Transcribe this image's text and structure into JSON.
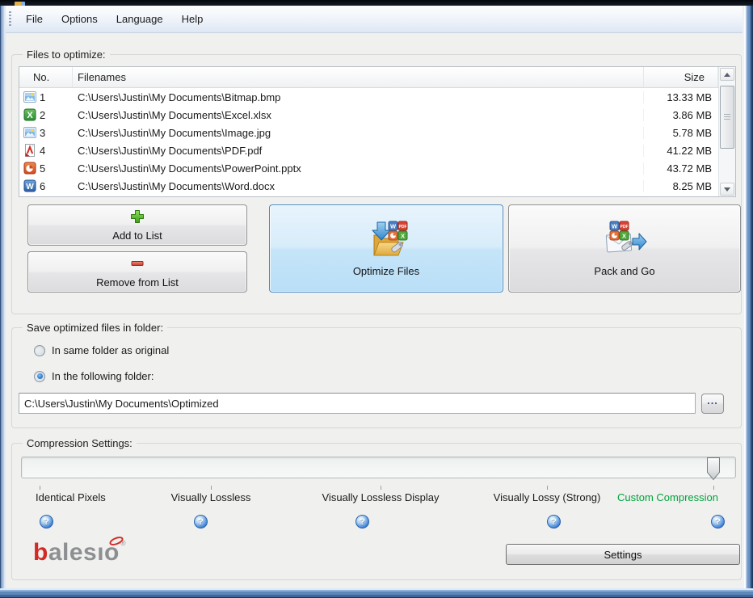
{
  "menu": {
    "items": [
      "File",
      "Options",
      "Language",
      "Help"
    ]
  },
  "files_group": {
    "label": "Files to optimize:",
    "columns": {
      "no": "No.",
      "filenames": "Filenames",
      "size": "Size"
    },
    "rows": [
      {
        "no": "1",
        "icon": "image-file-icon",
        "filename": "C:\\Users\\Justin\\My Documents\\Bitmap.bmp",
        "size": "13.33 MB"
      },
      {
        "no": "2",
        "icon": "excel-file-icon",
        "filename": "C:\\Users\\Justin\\My Documents\\Excel.xlsx",
        "size": "3.86 MB"
      },
      {
        "no": "3",
        "icon": "image-file-icon",
        "filename": "C:\\Users\\Justin\\My Documents\\Image.jpg",
        "size": "5.78 MB"
      },
      {
        "no": "4",
        "icon": "pdf-file-icon",
        "filename": "C:\\Users\\Justin\\My Documents\\PDF.pdf",
        "size": "41.22 MB"
      },
      {
        "no": "5",
        "icon": "powerpoint-file-icon",
        "filename": "C:\\Users\\Justin\\My Documents\\PowerPoint.pptx",
        "size": "43.72 MB"
      },
      {
        "no": "6",
        "icon": "word-file-icon",
        "filename": "C:\\Users\\Justin\\My Documents\\Word.docx",
        "size": "8.25 MB"
      }
    ],
    "add_button": "Add to List",
    "remove_button": "Remove from List",
    "optimize_button": "Optimize Files",
    "pack_button": "Pack and Go"
  },
  "save_group": {
    "label": "Save optimized files in folder:",
    "option_same_folder": "In same folder as original",
    "option_following_folder": "In the following folder:",
    "selected_option": "In the following folder:",
    "folder_path": "C:\\Users\\Justin\\My Documents\\Optimized",
    "browse_button": "..."
  },
  "compression_group": {
    "label": "Compression Settings:",
    "slider_position": "Custom Compression",
    "levels": [
      {
        "label": "Identical Pixels"
      },
      {
        "label": "Visually Lossless"
      },
      {
        "label": "Visually Lossless Display"
      },
      {
        "label": "Visually Lossy (Strong)"
      },
      {
        "label": "Custom Compression"
      }
    ],
    "help_icon_glyph": "?",
    "settings_button": "Settings"
  },
  "branding": {
    "logo_text_b": "b",
    "logo_text_rest": "alesıo",
    "registered_mark": "®"
  },
  "colors": {
    "custom_compression_green": "#00a33c",
    "optimize_highlight_border": "#4a89c0",
    "window_frame_blue": "#4a76ae",
    "help_icon_blue": "#3d7fd6"
  }
}
